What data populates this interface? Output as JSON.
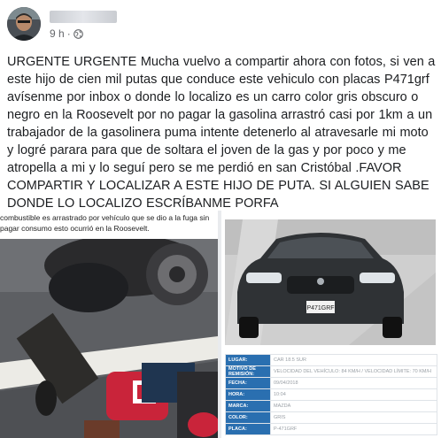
{
  "post": {
    "timestamp": "9 h",
    "body": "URGENTE URGENTE Mucha vuelvo a compartir ahora con fotos, si ven a este hijo de cien mil putas que conduce este vehiculo con placas P471grf avísenme por inbox o donde lo localizo es un carro color gris obscuro o negro en la Roosevelt por no pagar la gasolina arrastró casi por 1km a un trabajador de la gasolinera puma intente detenerlo al atravesarle mi moto y logré parara para que de soltara el joven de la gas y por poco y me atropella a mi y lo seguí pero se me perdió en san Cristóbal .FAVOR COMPARTIR Y LOCALIZAR A ESTE HIJO DE PUTA. SI ALGUIEN SABE DONDE LO LOCALIZO ESCRÍBANME PORFA"
  },
  "icons": {
    "privacy": "globe-icon",
    "separator": "dot"
  },
  "media": {
    "left_caption": "combustible es arrastrado por vehículo que se dio a la fuga sin pagar consumo esto ocurrió en la Roosevelt.",
    "plate_text": "P471GRF",
    "info_rows": [
      {
        "key": "LUGAR:",
        "value": "CAR 18.5 SUR"
      },
      {
        "key": "MOTIVO DE REMISIÓN:",
        "value": "VELOCIDAD DEL VEHÍCULO: 84 KM/H / VELOCIDAD LÍMITE: 70 KM/H"
      },
      {
        "key": "FECHA:",
        "value": "09/04/2018"
      },
      {
        "key": "HORA:",
        "value": "10:04"
      },
      {
        "key": "MARCA:",
        "value": "MAZDA"
      },
      {
        "key": "COLOR:",
        "value": "GRIS"
      },
      {
        "key": "PLACA:",
        "value": "P-471GRF"
      }
    ]
  },
  "colors": {
    "table_key_bg": "#2a6fb0",
    "meta_text": "#65676b"
  }
}
